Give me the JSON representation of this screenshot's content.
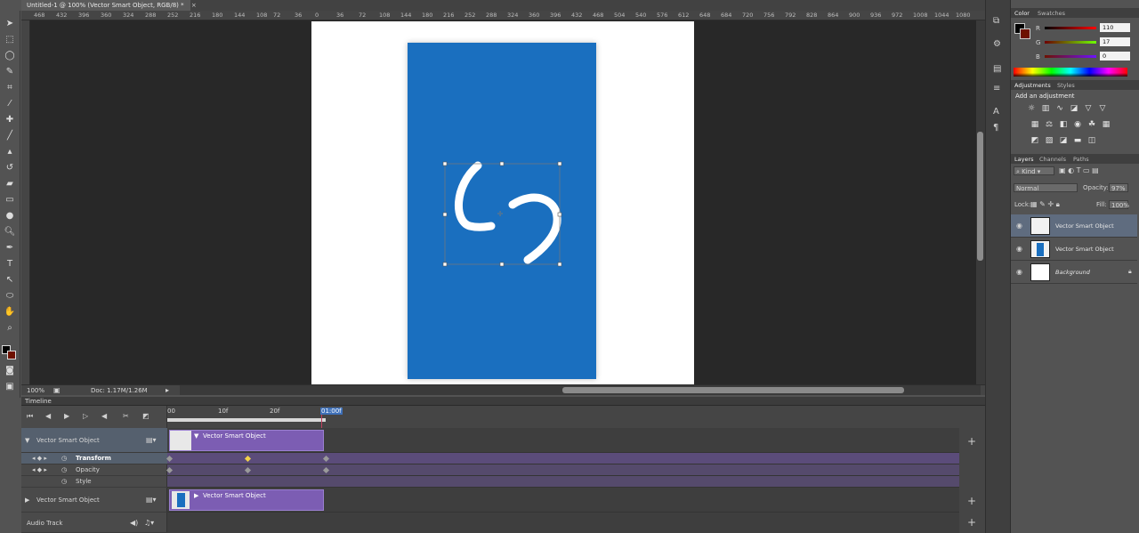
{
  "document": {
    "tab_title": "Untitled-1 @ 100% (Vector Smart Object, RGB/8) *",
    "close_glyph": "×"
  },
  "ruler": {
    "ticks": [
      "468",
      "432",
      "396",
      "360",
      "324",
      "288",
      "252",
      "216",
      "180",
      "144",
      "108",
      "72",
      "36",
      "0",
      "36",
      "72",
      "108",
      "144",
      "180",
      "216",
      "252",
      "288",
      "324",
      "360",
      "396",
      "432",
      "468",
      "504",
      "540",
      "576",
      "612",
      "648",
      "684",
      "720",
      "756",
      "792",
      "828",
      "864",
      "900",
      "936",
      "972",
      "1008",
      "1044",
      "1080"
    ]
  },
  "status": {
    "zoom": "100%",
    "doc_size": "Doc: 1.17M/1.26M"
  },
  "timeline": {
    "title": "Timeline",
    "time_labels": [
      "00",
      "10f",
      "20f",
      "01:00f"
    ],
    "tracks": [
      {
        "name": "Vector Smart Object",
        "clip_label": "Vector Smart Object"
      },
      {
        "name": "Vector Smart Object",
        "clip_label": "Vector Smart Object"
      }
    ],
    "properties": [
      "Transform",
      "Opacity",
      "Style"
    ],
    "audio_track": "Audio Track"
  },
  "color_panel": {
    "tabs": [
      "Color",
      "Swatches"
    ],
    "channels": [
      {
        "label": "R",
        "value": "110"
      },
      {
        "label": "G",
        "value": "17"
      },
      {
        "label": "B",
        "value": "0"
      }
    ]
  },
  "adjustments_panel": {
    "tabs": [
      "Adjustments",
      "Styles"
    ],
    "heading": "Add an adjustment"
  },
  "layers_panel": {
    "tabs": [
      "Layers",
      "Channels",
      "Paths"
    ],
    "filter_kind": "Kind",
    "blend_mode": "Normal",
    "opacity_label": "Opacity:",
    "opacity_value": "97%",
    "lock_label": "Lock:",
    "fill_label": "Fill:",
    "fill_value": "100%",
    "layers": [
      {
        "name": "Vector Smart Object",
        "selected": true
      },
      {
        "name": "Vector Smart Object",
        "selected": false
      },
      {
        "name": "Background",
        "selected": false
      }
    ]
  },
  "colors": {
    "canvas_blue": "#1a6fbf",
    "clip_purple": "#7c5db3",
    "panel_bg": "#535353"
  }
}
